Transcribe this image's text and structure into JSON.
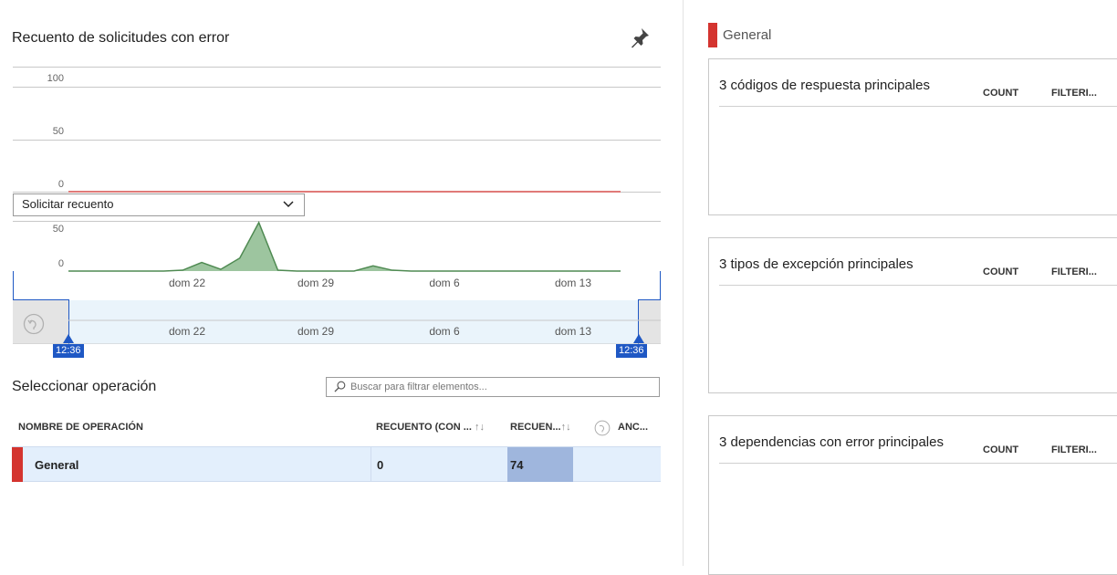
{
  "chart": {
    "title": "Recuento de solicitudes con error",
    "top_ticks": [
      "100",
      "50",
      "0"
    ],
    "dropdown_label": "Solicitar recuento",
    "bottom_ticks": [
      "50",
      "0"
    ],
    "date_labels": [
      "dom 22",
      "dom 29",
      "dom 6",
      "dom 13"
    ],
    "range_start": "12:36",
    "range_end": "12:36"
  },
  "chart_data": {
    "type": "area",
    "title": "",
    "series": [
      {
        "name": "Solicitar recuento",
        "values": [
          0,
          0,
          0,
          0,
          0,
          0,
          1,
          10,
          2,
          15,
          56,
          1,
          0,
          0,
          0,
          0,
          6,
          1,
          0,
          0,
          0,
          0,
          0,
          0,
          0,
          0,
          0,
          0,
          0,
          0
        ]
      }
    ],
    "ylim": [
      0,
      60
    ],
    "color": "#4f8a52"
  },
  "operations": {
    "title": "Seleccionar operación",
    "search_placeholder": "Buscar para filtrar elementos...",
    "headers": {
      "name": "NOMBRE DE OPERACIÓN",
      "count": "RECUENTO (CON ...",
      "count_sort": "↑↓",
      "recuen": "RECUEN...",
      "recuen_sort": "↑↓",
      "anc": "ANC..."
    },
    "rows": [
      {
        "name": "General",
        "count": "0",
        "recuen": "74",
        "fill_fraction": 0.5
      }
    ]
  },
  "right": {
    "section_label": "General",
    "panels": [
      {
        "title": "3 códigos de respuesta principales",
        "col1": "COUNT",
        "col2": "FILTERI..."
      },
      {
        "title": "3 tipos de excepción principales",
        "col1": "COUNT",
        "col2": "FILTERI..."
      },
      {
        "title": "3 dependencias con error principales",
        "col1": "COUNT",
        "col2": "FILTERI..."
      }
    ]
  },
  "colors": {
    "accent_red": "#d4342f",
    "selection_blue": "#1f58c4",
    "area_green": "#4f8a52"
  }
}
